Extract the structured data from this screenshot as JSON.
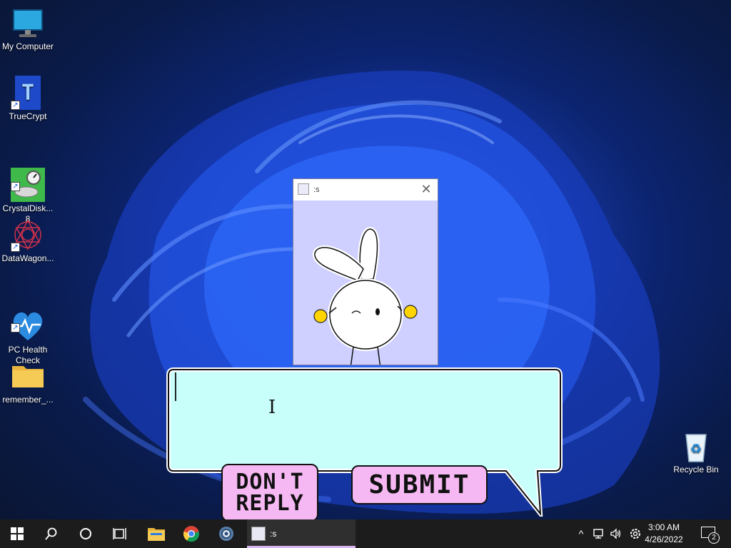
{
  "desktop": {
    "icons": [
      {
        "label": "My Computer"
      },
      {
        "label": "TrueCrypt"
      },
      {
        "label": "CrystalDisk...\n8"
      },
      {
        "label": "DataWagon..."
      },
      {
        "label": "PC Health\nCheck"
      },
      {
        "label": "remember_..."
      },
      {
        "label": "Recycle Bin"
      }
    ]
  },
  "window": {
    "title": ":s",
    "close_glyph": "✕"
  },
  "dialog": {
    "reply_value": "",
    "dont_reply_label": "DON'T REPLY",
    "submit_label": "SUBMIT",
    "bubble_color": "#c8fffb",
    "button_color": "#f6b8f2"
  },
  "taskbar": {
    "active_app_label": ":s",
    "time": "3:00 AM",
    "date": "4/26/2022",
    "notification_count": "2",
    "tray_chevron": "^"
  }
}
